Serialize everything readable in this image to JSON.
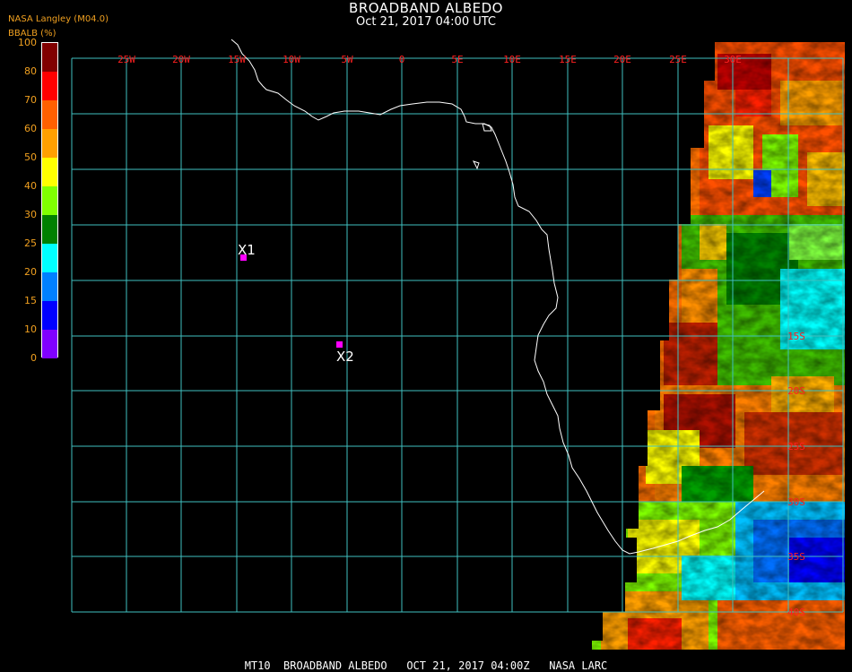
{
  "header": {
    "title": "BROADBAND ALBEDO",
    "subtitle": "Oct 21, 2017 04:00 UTC",
    "org": "NASA Langley (M04.0)",
    "unit": "BBALB (%)"
  },
  "colorbar": {
    "labels": [
      "100",
      "80",
      "70",
      "60",
      "50",
      "40",
      "30",
      "25",
      "20",
      "15",
      "10",
      "0"
    ],
    "colors": [
      "#800000",
      "#ff0000",
      "#ff6000",
      "#ffa000",
      "#ffff00",
      "#80ff00",
      "#008000",
      "#00ffff",
      "#0080ff",
      "#0000ff",
      "#8000ff"
    ]
  },
  "map": {
    "lon_labels": [
      "25W",
      "20W",
      "15W",
      "10W",
      "5W",
      "0",
      "5E",
      "10E",
      "15E",
      "20E",
      "25E",
      "30E"
    ],
    "lat_labels_right": [
      "15S",
      "20S",
      "25S",
      "30S",
      "35S",
      "40S"
    ],
    "grid_color": "#40c0c0",
    "label_color": "#ff2020",
    "coast_color": "#ffffff",
    "markers": [
      {
        "label": "X1",
        "color": "#ff00ff"
      },
      {
        "label": "X2",
        "color": "#ff00ff"
      }
    ]
  },
  "footer": {
    "text": "MT10  BROADBAND ALBEDO   OCT 21, 2017 04:00Z   NASA LARC"
  }
}
